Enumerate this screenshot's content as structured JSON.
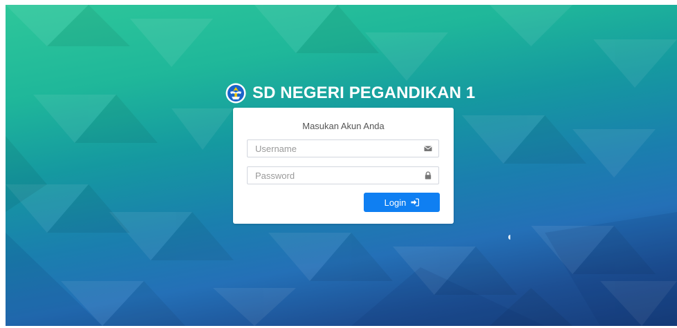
{
  "school": {
    "name": "SD NEGERI PEGANDIKAN 1",
    "logo_icon": "tut-wuri-handayani-logo"
  },
  "login_form": {
    "prompt": "Masukan Akun Anda",
    "username": {
      "value": "",
      "placeholder": "Username",
      "icon": "envelope-icon"
    },
    "password": {
      "value": "",
      "placeholder": "Password",
      "icon": "lock-icon"
    },
    "submit": {
      "label": "Login",
      "icon": "sign-in-icon"
    }
  },
  "colors": {
    "button": "#0f7ff2",
    "background_top": "#2ec79a",
    "background_bottom": "#163c7a"
  }
}
